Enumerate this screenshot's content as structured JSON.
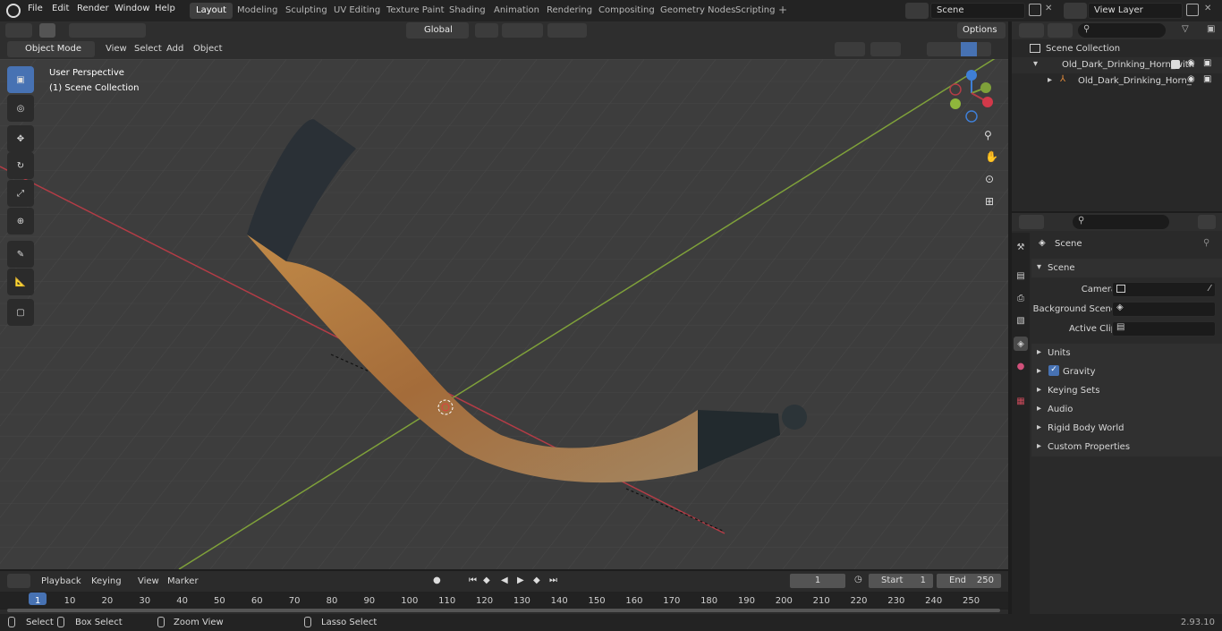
{
  "menu": [
    "File",
    "Edit",
    "Render",
    "Window",
    "Help"
  ],
  "workspaces": [
    "Layout",
    "Modeling",
    "Sculpting",
    "UV Editing",
    "Texture Paint",
    "Shading",
    "Animation",
    "Rendering",
    "Compositing",
    "Geometry Nodes",
    "Scripting"
  ],
  "scene_name": "Scene",
  "view_layer": "View Layer",
  "transform_orientation": "Global",
  "options_label": "Options",
  "mode": "Object Mode",
  "viewport_menu": [
    "View",
    "Select",
    "Add",
    "Object"
  ],
  "viewport_overlay": {
    "line1": "User Perspective",
    "line2": "(1) Scene Collection"
  },
  "outliner": {
    "root": "Scene Collection",
    "item1": "Old_Dark_Drinking_Horn_with",
    "item2": "Old_Dark_Drinking_Horn_"
  },
  "properties": {
    "header": "Scene",
    "section": "Scene",
    "camera_label": "Camera",
    "bg_label": "Background Scene",
    "clip_label": "Active Clip",
    "panels": [
      "Units",
      "Gravity",
      "Keying Sets",
      "Audio",
      "Rigid Body World",
      "Custom Properties"
    ]
  },
  "timeline": {
    "menu": [
      "Playback",
      "Keying",
      "View",
      "Marker"
    ],
    "current_frame": "1",
    "start_label": "Start",
    "start": "1",
    "end_label": "End",
    "end": "250",
    "ticks": [
      "1",
      "10",
      "20",
      "30",
      "40",
      "50",
      "60",
      "70",
      "80",
      "90",
      "100",
      "110",
      "120",
      "130",
      "140",
      "150",
      "160",
      "170",
      "180",
      "190",
      "200",
      "210",
      "220",
      "230",
      "240",
      "250"
    ]
  },
  "status": {
    "select": "Select",
    "box": "Box Select",
    "zoom": "Zoom View",
    "lasso": "Lasso Select",
    "version": "2.93.10"
  },
  "colors": {
    "accent": "#4772b3",
    "x_axis": "#b43c46",
    "y_axis": "#7fa13a",
    "z_axis": "#3f7fd6"
  }
}
